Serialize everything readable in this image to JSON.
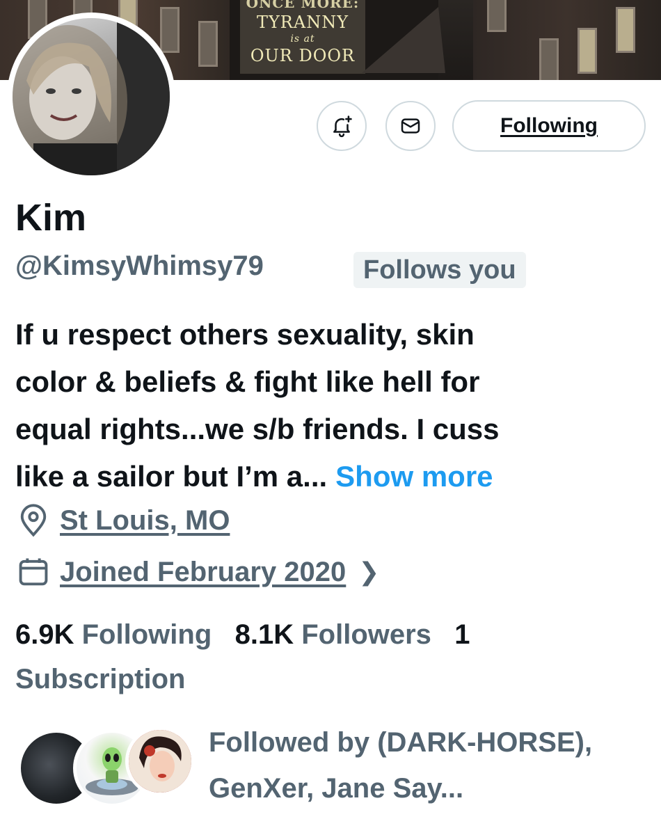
{
  "banner": {
    "sign_line1": "ONCE MORE:",
    "sign_line2": "TYRANNY",
    "sign_line3": "is at",
    "sign_line4": "OUR DOOR"
  },
  "actions": {
    "following_label": "Following"
  },
  "profile": {
    "name": "Kim",
    "handle": "@KimsyWhimsy79",
    "follows_you": "Follows you",
    "bio_lines": [
      "If u respect others sexuality, skin",
      "color & beliefs & fight like hell for",
      "equal rights...we s/b friends. I cuss",
      "like a sailor but I’m a..."
    ],
    "show_more": "Show more",
    "location": "St Louis, MO",
    "joined": "Joined February 2020"
  },
  "stats": {
    "following_count": "6.9K",
    "following_label": "Following",
    "followers_count": "8.1K",
    "followers_label": "Followers",
    "subscriptions_count": "1",
    "subscriptions_label": "Subscription"
  },
  "followed_by": {
    "text": "Followed by (DARK-HORSE), GenXer, Jane Say..."
  },
  "colors": {
    "accent": "#1d9bf0",
    "secondary_text": "#536471",
    "primary_text": "#0f1419",
    "border": "#cfd9de"
  },
  "icons": [
    "bell-plus-icon",
    "envelope-icon",
    "location-pin-icon",
    "calendar-icon",
    "chevron-right-icon"
  ]
}
